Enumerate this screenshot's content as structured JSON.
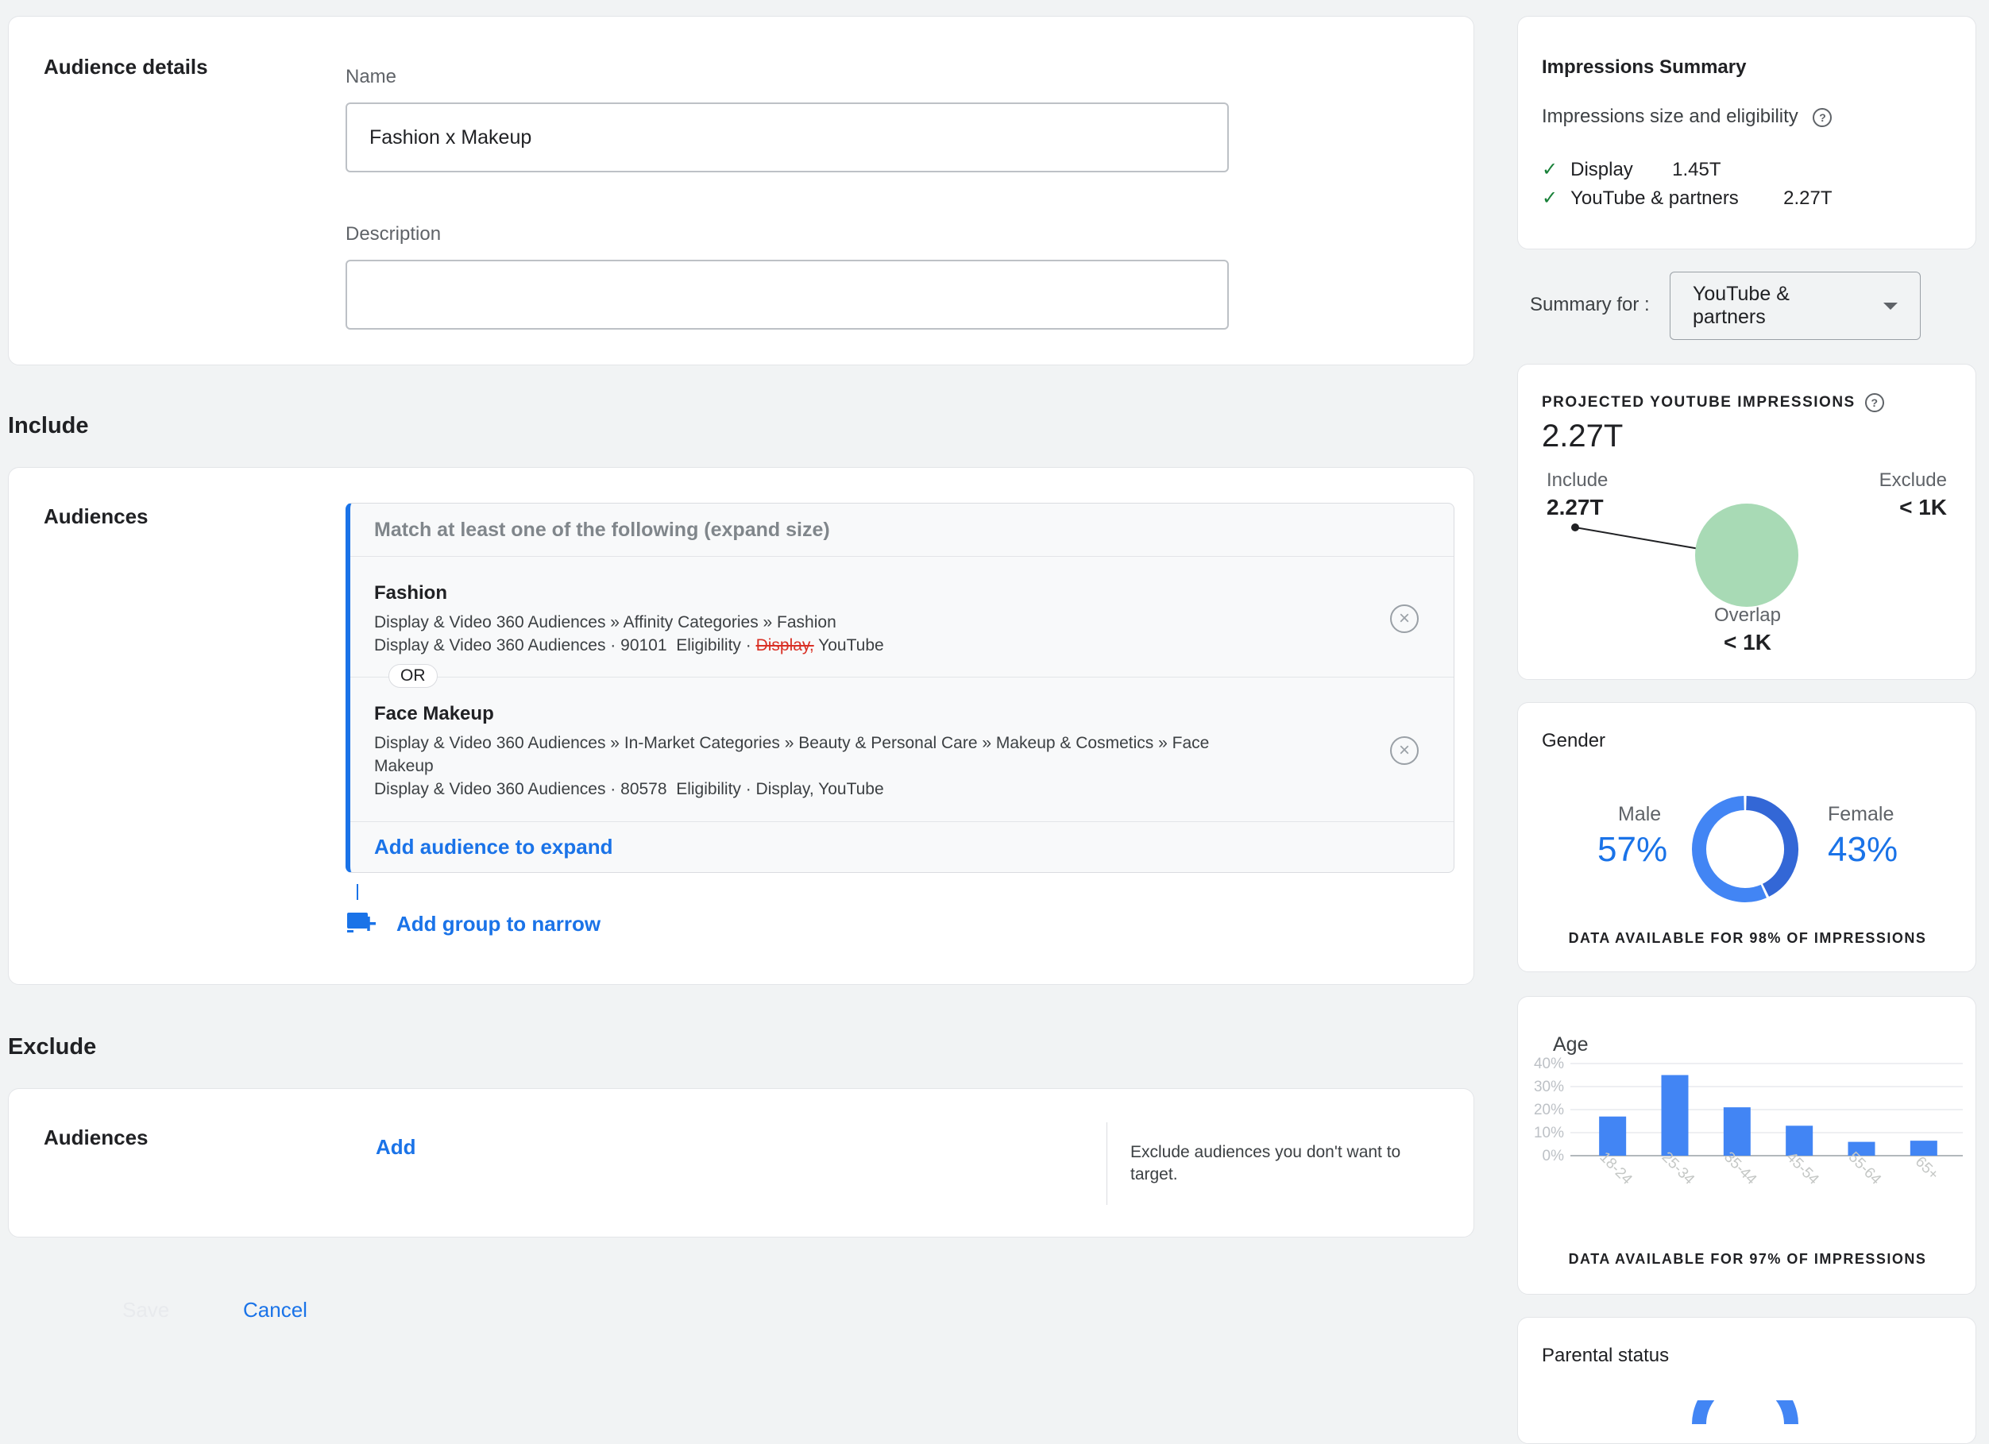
{
  "details": {
    "section_label": "Audience details",
    "name_label": "Name",
    "name_value": "Fashion x Makeup",
    "description_label": "Description",
    "description_value": ""
  },
  "include": {
    "title": "Include",
    "audiences_label": "Audiences",
    "group_header": "Match at least one of the following (expand size)",
    "items": [
      {
        "title": "Fashion",
        "path": "Display & Video 360 Audiences » Affinity Categories » Fashion",
        "meta_prefix": "Display & Video 360 Audiences · 90101  Eligibility · ",
        "meta_struck": "Display,",
        "meta_suffix": " YouTube"
      },
      {
        "title": "Face Makeup",
        "path": "Display & Video 360 Audiences » In-Market Categories » Beauty & Personal Care » Makeup & Cosmetics » Face Makeup",
        "meta": "Display & Video 360 Audiences · 80578  Eligibility · Display, YouTube"
      }
    ],
    "or_label": "OR",
    "add_expand": "Add audience to expand",
    "add_group": "Add group to narrow"
  },
  "exclude": {
    "title": "Exclude",
    "audiences_label": "Audiences",
    "add_label": "Add",
    "hint": "Exclude audiences you don't want to target."
  },
  "actions": {
    "save": "Save",
    "cancel": "Cancel"
  },
  "summary": {
    "title": "Impressions Summary",
    "subtitle": "Impressions size and eligibility",
    "rows": [
      {
        "label": "Display",
        "value": "1.45T"
      },
      {
        "label": "YouTube & partners",
        "value": "2.27T"
      }
    ],
    "summary_for_label": "Summary for :",
    "summary_for_value": "YouTube & partners"
  },
  "projected": {
    "title": "PROJECTED YOUTUBE IMPRESSIONS",
    "value": "2.27T",
    "include_label": "Include",
    "include_value": "2.27T",
    "exclude_label": "Exclude",
    "exclude_value": "< 1K",
    "overlap_label": "Overlap",
    "overlap_value": "< 1K"
  },
  "gender": {
    "title": "Gender",
    "male_label": "Male",
    "male_value": "57%",
    "female_label": "Female",
    "female_value": "43%",
    "footnote": "DATA AVAILABLE FOR 98% OF IMPRESSIONS",
    "colors": {
      "male": "#4285f4",
      "female": "#3367d6"
    }
  },
  "age": {
    "title": "Age",
    "footnote": "DATA AVAILABLE FOR 97% OF IMPRESSIONS"
  },
  "parental": {
    "title": "Parental status"
  },
  "chart_data": {
    "type": "bar",
    "categories": [
      "18-24",
      "25-34",
      "35-44",
      "45-54",
      "55-64",
      "65+"
    ],
    "values": [
      17,
      35,
      21,
      13,
      6,
      6.5
    ],
    "ylim": [
      0,
      40
    ],
    "yticks": [
      "0%",
      "10%",
      "20%",
      "30%",
      "40%"
    ],
    "grid": true,
    "color": "#4285f4"
  }
}
